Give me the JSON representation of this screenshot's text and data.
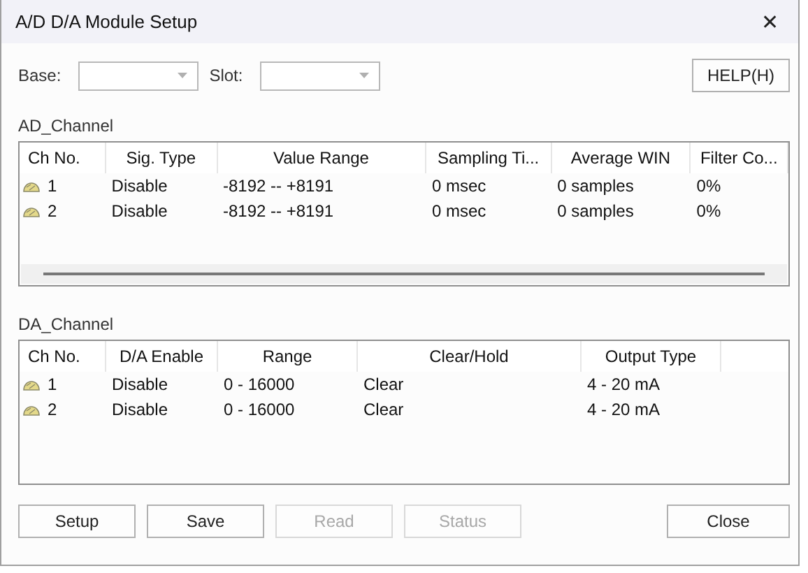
{
  "window": {
    "title": "A/D D/A Module Setup",
    "close": "✕"
  },
  "selectors": [
    {
      "label": "Base:"
    },
    {
      "label": "Slot:"
    }
  ],
  "help_button": {
    "label": "HELP(H)"
  },
  "ad_channel": {
    "title": "AD_Channel",
    "columns": [
      "Ch No.",
      "Sig. Type",
      "Value Range",
      "Sampling Ti...",
      "Average WIN",
      "Filter Co..."
    ],
    "rows": [
      [
        "1",
        "Disable",
        "-8192 -- +8191",
        "0 msec",
        "0 samples",
        "0%"
      ],
      [
        "2",
        "Disable",
        "-8192 -- +8191",
        "0 msec",
        "0 samples",
        "0%"
      ]
    ]
  },
  "da_channel": {
    "title": "DA_Channel",
    "columns": [
      "Ch No.",
      "D/A Enable",
      "Range",
      "Clear/Hold",
      "Output Type"
    ],
    "rows": [
      [
        "1",
        "Disable",
        "0 - 16000",
        "Clear",
        "4 - 20 mA"
      ],
      [
        "2",
        "Disable",
        "0 - 16000",
        "Clear",
        "4 - 20 mA"
      ]
    ]
  },
  "buttons": [
    {
      "label": "Setup",
      "disabled": false
    },
    {
      "label": "Save",
      "disabled": false
    },
    {
      "label": "Read",
      "disabled": true
    },
    {
      "label": "Status",
      "disabled": true
    },
    {
      "label": "Close",
      "disabled": false
    }
  ]
}
